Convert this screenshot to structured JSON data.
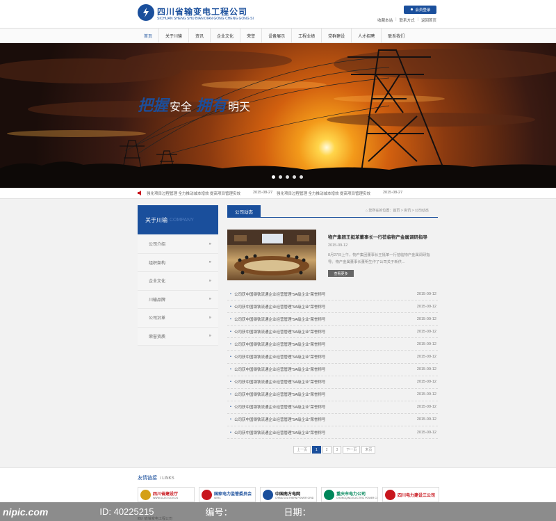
{
  "header": {
    "company_name": "四川省输变电工程公司",
    "company_en": "SICHUAN SHENG SHU BIAN DIAN GONG CHENG GONG SI",
    "login_label": "会员登录",
    "top_links": [
      "收藏本站",
      "联系方式",
      "返回首页"
    ]
  },
  "nav": {
    "items": [
      "首页",
      "关于川输",
      "资讯",
      "企业文化",
      "荣誉",
      "设备展示",
      "工程业绩",
      "党群建设",
      "人才招聘",
      "联系我们"
    ],
    "active_index": 0
  },
  "banner": {
    "slogan_1a": "把握",
    "slogan_1b": "安全",
    "slogan_2a": "拥有",
    "slogan_2b": "明天",
    "dots": 5,
    "active_dot": 0
  },
  "ticker": {
    "items": [
      {
        "text": "强化项目过程管理 全力推动减本增效 提高项目管理实效",
        "date": "2015-08-27"
      },
      {
        "text": "强化项目过程管理 全力推动减本增效 提高项目管理实效",
        "date": "2015-08-27"
      }
    ]
  },
  "sidebar": {
    "title": "关于川输",
    "title_en": "COMPANY",
    "items": [
      "公司介绍",
      "组织架构",
      "企业文化",
      "川输品牌",
      "公司沿革",
      "荣誉资质"
    ],
    "arrow": "»"
  },
  "main": {
    "tab_label": "公司动态",
    "breadcrumb": "您所在的位置：首页 > 资讯 > 公司动态",
    "featured": {
      "title": "物产集团王挺革董事长一行莅临物产金属调研指导",
      "date": "2015-09-12",
      "desc": "8月27日上午，物产集团董事长王挺革一行莅临物产金属调研指导。物产金属董事长董明生作了公司关于新供...",
      "more_label": "查看更多"
    },
    "news": [
      {
        "title": "公司获中国钢铁流通企业经营管理“5A级企业”荣誉称号",
        "date": "2015-09-12"
      },
      {
        "title": "公司获中国钢铁流通企业经营管理“5A级企业”荣誉称号",
        "date": "2015-09-12"
      },
      {
        "title": "公司获中国钢铁流通企业经营管理“5A级企业”荣誉称号",
        "date": "2015-09-12"
      },
      {
        "title": "公司获中国钢铁流通企业经营管理“5A级企业”荣誉称号",
        "date": "2015-09-12"
      },
      {
        "title": "公司获中国钢铁流通企业经营管理“5A级企业”荣誉称号",
        "date": "2015-09-12"
      },
      {
        "title": "公司获中国钢铁流通企业经营管理“5A级企业”荣誉称号",
        "date": "2015-09-12"
      },
      {
        "title": "公司获中国钢铁流通企业经营管理“5A级企业”荣誉称号",
        "date": "2015-09-12"
      },
      {
        "title": "公司获中国钢铁流通企业经营管理“5A级企业”荣誉称号",
        "date": "2015-09-12"
      },
      {
        "title": "公司获中国钢铁流通企业经营管理“5A级企业”荣誉称号",
        "date": "2015-09-12"
      },
      {
        "title": "公司获中国钢铁流通企业经营管理“5A级企业”荣誉称号",
        "date": "2015-09-12"
      },
      {
        "title": "公司获中国钢铁流通企业经营管理“5A级企业”荣誉称号",
        "date": "2015-09-12"
      },
      {
        "title": "公司获中国钢铁流通企业经营管理“5A级企业”荣誉称号",
        "date": "2015-09-12"
      }
    ],
    "pager": {
      "prev": "上一页",
      "pages": [
        "1",
        "2",
        "3"
      ],
      "current": "1",
      "next": "下一页",
      "last": "末页"
    }
  },
  "friend_links": {
    "title": "友情链接",
    "title_en": "/ LINKS",
    "logos": [
      {
        "name": "四川省建设厅",
        "sub": "WWW.SCJST.GOV.CN",
        "color": "#c8161d",
        "emblem": "#d4a017"
      },
      {
        "name": "国家电力监管委员会",
        "sub": "SERC",
        "color": "#1a4f9c",
        "emblem": "#c8161d"
      },
      {
        "name": "中国南方电网",
        "sub": "CHINA SOUTHERN POWER GRID",
        "color": "#111111",
        "emblem": "#1a4f9c"
      },
      {
        "name": "重庆市电力公司",
        "sub": "CHONGQING ELECTRIC POWER CORP",
        "color": "#00875a",
        "emblem": "#00875a"
      },
      {
        "name": "四川电力建设三公司",
        "sub": "",
        "color": "#c8161d",
        "emblem": "#c8161d"
      }
    ],
    "copyright": "四川省输变电工程公司"
  },
  "watermark": {
    "brand": "nipic.com",
    "id_text": "ID: 40225215",
    "author": "编号：",
    "date": "日期："
  }
}
